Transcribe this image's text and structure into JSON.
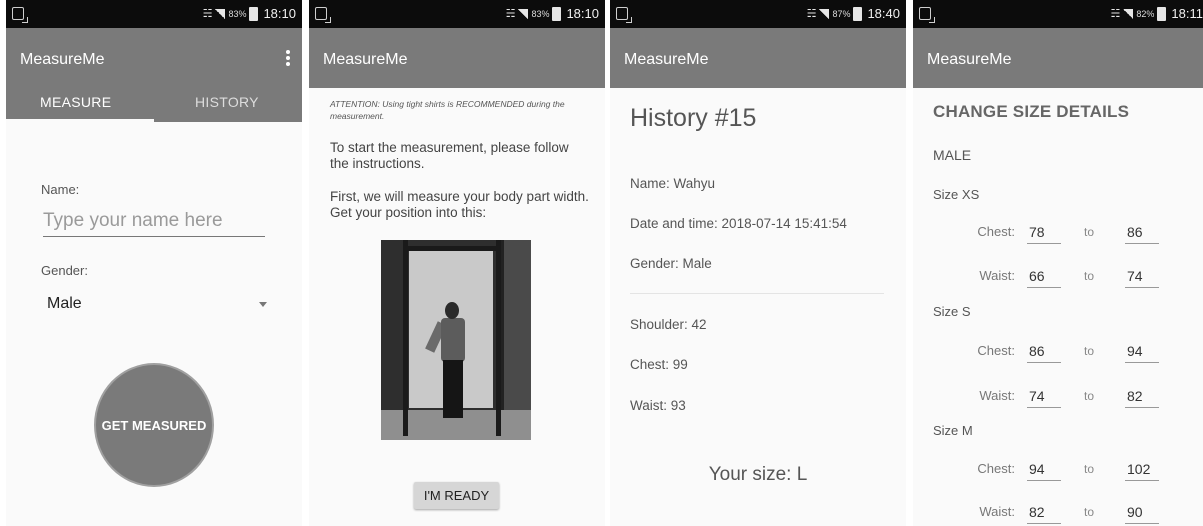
{
  "app_name": "MeasureMe",
  "screens": [
    {
      "status": {
        "battery": "83%",
        "time": "18:10"
      }
    },
    {
      "status": {
        "battery": "83%",
        "time": "18:10"
      }
    },
    {
      "status": {
        "battery": "87%",
        "time": "18:40"
      }
    },
    {
      "status": {
        "battery": "82%",
        "time": "18:11"
      }
    }
  ],
  "icons": {
    "app": "notification-app-icon",
    "wifi": "wifi-icon",
    "signal": "signal-icon",
    "battery": "battery-icon",
    "menu": "overflow-menu-icon",
    "dropdown": "dropdown-arrow-icon"
  },
  "measure_screen": {
    "tabs": [
      "MEASURE",
      "HISTORY"
    ],
    "name_label": "Name:",
    "name_placeholder": "Type your name here",
    "gender_label": "Gender:",
    "gender_value": "Male",
    "button": "GET MEASURED"
  },
  "instruction_screen": {
    "attention": "ATTENTION: Using tight shirts is RECOMMENDED during the measurement.",
    "instruction_1": "To start the measurement, please follow the instructions.",
    "instruction_2": "First, we will measure your body part width. Get your position into this:",
    "button": "I'M READY"
  },
  "history_screen": {
    "title": "History #15",
    "name": "Name: Wahyu",
    "datetime": "Date and time: 2018-07-14 15:41:54",
    "gender": "Gender: Male",
    "shoulder": "Shoulder: 42",
    "chest": "Chest: 99",
    "waist": "Waist: 93",
    "your_size": "Your size: L"
  },
  "size_screen": {
    "header": "CHANGE SIZE DETAILS",
    "sex": "MALE",
    "to_word": "to",
    "sizes": [
      {
        "name": "Size XS",
        "rows": [
          {
            "label": "Chest:",
            "from": "78",
            "to": "86"
          },
          {
            "label": "Waist:",
            "from": "66",
            "to": "74"
          }
        ]
      },
      {
        "name": "Size S",
        "rows": [
          {
            "label": "Chest:",
            "from": "86",
            "to": "94"
          },
          {
            "label": "Waist:",
            "from": "74",
            "to": "82"
          }
        ]
      },
      {
        "name": "Size M",
        "rows": [
          {
            "label": "Chest:",
            "from": "94",
            "to": "102"
          },
          {
            "label": "Waist:",
            "from": "82",
            "to": "90"
          }
        ]
      }
    ]
  }
}
